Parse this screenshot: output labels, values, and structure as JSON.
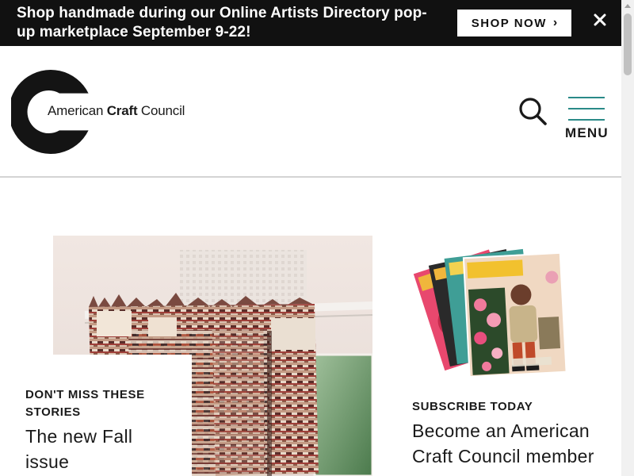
{
  "banner": {
    "message": "Shop handmade during our Online Artists Directory pop-up marketplace September 9-22!",
    "cta_label": "SHOP NOW",
    "cta_chevron": "›",
    "close_icon": "close-icon"
  },
  "header": {
    "logo": {
      "name_regular_1": "American ",
      "name_bold": "Craft",
      "name_regular_2": " Council"
    },
    "search_icon": "search-icon",
    "menu_label": "MENU"
  },
  "feature": {
    "kicker": "DON'T MISS THESE STORIES",
    "headline": "The new Fall issue"
  },
  "subscribe": {
    "kicker": "SUBSCRIBE TODAY",
    "headline": "Become an American Craft Council member"
  },
  "colors": {
    "banner_bg": "#111111",
    "accent_teal": "#2a8a88",
    "text": "#1a1a1a"
  }
}
